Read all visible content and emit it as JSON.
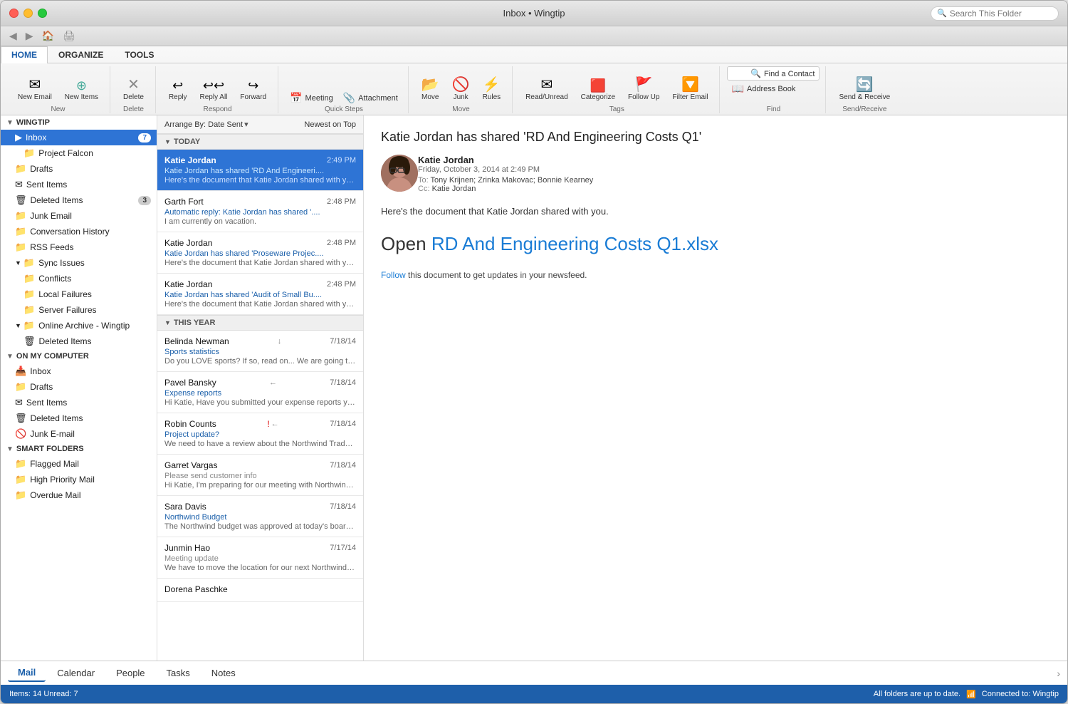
{
  "window": {
    "title": "Inbox • Wingtip",
    "search_placeholder": "Search This Folder"
  },
  "ribbon": {
    "tabs": [
      "HOME",
      "ORGANIZE",
      "TOOLS"
    ],
    "active_tab": "HOME",
    "buttons": {
      "new_email": "New Email",
      "new_items": "New Items",
      "delete": "Delete",
      "reply": "Reply",
      "reply_all": "Reply All",
      "forward": "Forward",
      "meeting": "Meeting",
      "attachment": "Attachment",
      "move": "Move",
      "junk": "Junk",
      "rules": "Rules",
      "read_unread": "Read/Unread",
      "categorize": "Categorize",
      "follow_up": "Follow Up",
      "filter_email": "Filter Email",
      "find_contact": "Find a Contact",
      "address_book": "Address Book",
      "send_receive": "Send & Receive"
    }
  },
  "sidebar": {
    "sections": [
      {
        "name": "WINGTIP",
        "expanded": true,
        "items": [
          {
            "label": "Inbox",
            "icon": "📥",
            "badge": "7",
            "level": 1,
            "selected": true
          },
          {
            "label": "Project Falcon",
            "icon": "📁",
            "level": 2
          },
          {
            "label": "Drafts",
            "icon": "📁",
            "level": 1
          },
          {
            "label": "Sent Items",
            "icon": "✉",
            "level": 1
          },
          {
            "label": "Deleted Items",
            "icon": "🗑",
            "badge": "3",
            "level": 1
          },
          {
            "label": "Junk Email",
            "icon": "📁",
            "level": 1
          },
          {
            "label": "Conversation History",
            "icon": "📁",
            "level": 1
          },
          {
            "label": "RSS Feeds",
            "icon": "📁",
            "level": 1
          },
          {
            "label": "Sync Issues",
            "icon": "📁",
            "level": 1,
            "expandable": true
          },
          {
            "label": "Conflicts",
            "icon": "📁",
            "level": 2
          },
          {
            "label": "Local Failures",
            "icon": "📁",
            "level": 2
          },
          {
            "label": "Server Failures",
            "icon": "📁",
            "level": 2
          },
          {
            "label": "Online Archive - Wingtip",
            "icon": "📁",
            "level": 1,
            "expandable": true
          },
          {
            "label": "Deleted Items",
            "icon": "🗑",
            "level": 2
          }
        ]
      },
      {
        "name": "ON MY COMPUTER",
        "expanded": true,
        "items": [
          {
            "label": "Inbox",
            "icon": "📥",
            "level": 1
          },
          {
            "label": "Drafts",
            "icon": "📁",
            "level": 1
          },
          {
            "label": "Sent Items",
            "icon": "✉",
            "level": 1
          },
          {
            "label": "Deleted Items",
            "icon": "🗑",
            "level": 1
          },
          {
            "label": "Junk E-mail",
            "icon": "🚫",
            "level": 1
          }
        ]
      },
      {
        "name": "SMART FOLDERS",
        "expanded": true,
        "items": [
          {
            "label": "Flagged Mail",
            "icon": "📁",
            "level": 1
          },
          {
            "label": "High Priority Mail",
            "icon": "📁",
            "level": 1
          },
          {
            "label": "Overdue Mail",
            "icon": "📁",
            "level": 1
          }
        ]
      }
    ]
  },
  "email_list": {
    "sort_label": "Arrange By: Date Sent",
    "sort_order": "Newest on Top",
    "groups": [
      {
        "label": "TODAY",
        "emails": [
          {
            "sender": "Katie Jordan",
            "subject": "Katie Jordan has shared 'RD And Engineeri....",
            "preview": "Here's the document that Katie Jordan shared with you....",
            "time": "2:49 PM",
            "unread": true,
            "selected": true
          },
          {
            "sender": "Garth Fort",
            "subject": "Automatic reply: Katie Jordan has shared '....",
            "preview": "I am currently on vacation.",
            "time": "2:48 PM",
            "unread": false,
            "selected": false
          },
          {
            "sender": "Katie Jordan",
            "subject": "Katie Jordan has shared 'Proseware Projec....",
            "preview": "Here's the document that Katie Jordan shared with you....",
            "time": "2:48 PM",
            "unread": false,
            "selected": false
          },
          {
            "sender": "Katie Jordan",
            "subject": "Katie Jordan has shared 'Audit of Small Bu....",
            "preview": "Here's the document that Katie Jordan shared with you....",
            "time": "2:48 PM",
            "unread": false,
            "selected": false
          }
        ]
      },
      {
        "label": "THIS YEAR",
        "emails": [
          {
            "sender": "Belinda Newman",
            "subject": "Sports statistics",
            "preview": "Do you LOVE sports? If so, read on... We are going to....",
            "time": "7/18/14",
            "unread": false,
            "flag_download": true,
            "selected": false
          },
          {
            "sender": "Pavel Bansky",
            "subject": "Expense reports",
            "preview": "Hi Katie, Have you submitted your expense reports yet....",
            "time": "7/18/14",
            "unread": false,
            "flag_replied": true,
            "selected": false
          },
          {
            "sender": "Robin Counts",
            "subject": "Project update?",
            "preview": "We need to have a review about the Northwind Traders....",
            "time": "7/18/14",
            "unread": false,
            "flag_important": true,
            "flag_replied": true,
            "selected": false
          },
          {
            "sender": "Garret Vargas",
            "subject": "Please send customer info",
            "preview": "Hi Katie, I'm preparing for our meeting with Northwind,....",
            "time": "7/18/14",
            "unread": false,
            "selected": false
          },
          {
            "sender": "Sara Davis",
            "subject": "Northwind Budget",
            "preview": "The Northwind budget was approved at today's board....",
            "time": "7/18/14",
            "unread": false,
            "selected": false
          },
          {
            "sender": "Junmin Hao",
            "subject": "Meeting update",
            "preview": "We have to move the location for our next Northwind Tr....",
            "time": "7/17/14",
            "unread": false,
            "selected": false
          },
          {
            "sender": "Dorena Paschke",
            "subject": "",
            "preview": "",
            "time": "",
            "unread": false,
            "selected": false
          }
        ]
      }
    ]
  },
  "reading_pane": {
    "title": "Katie Jordan has shared 'RD And Engineering Costs Q1'",
    "from": "Katie Jordan",
    "date": "Friday, October 3, 2014 at 2:49 PM",
    "to": "Tony Krijnen;  Zrinka Makovac;  Bonnie Kearney",
    "cc": "Katie Jordan",
    "body_intro": "Here's the document that Katie Jordan shared with you.",
    "open_label": "Open ",
    "file_link": "RD And Engineering Costs Q1.xlsx",
    "follow_text": "Follow",
    "follow_suffix": " this document to get updates in your newsfeed."
  },
  "bottom_nav": {
    "items": [
      "Mail",
      "Calendar",
      "People",
      "Tasks",
      "Notes"
    ],
    "active": "Mail"
  },
  "status_bar": {
    "items": "Items: 14",
    "unread": "Unread: 7",
    "sync_status": "All folders are up to date.",
    "connection": "Connected to: Wingtip"
  }
}
